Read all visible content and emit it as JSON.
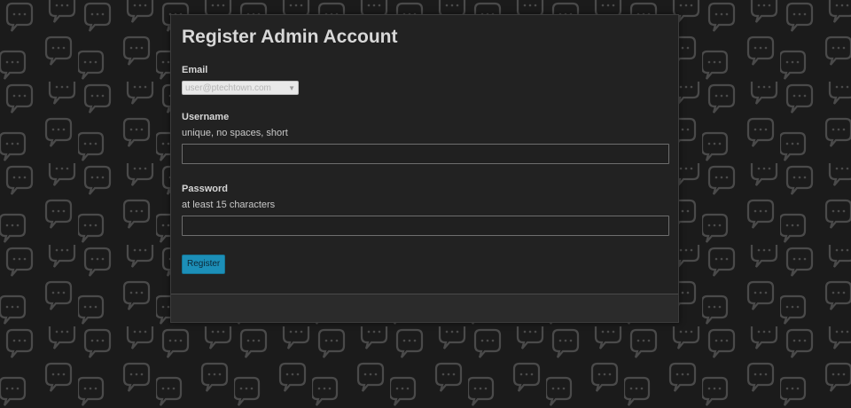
{
  "form": {
    "title": "Register Admin Account",
    "email": {
      "label": "Email",
      "selected_value": "user@ptechtown.com"
    },
    "username": {
      "label": "Username",
      "help": "unique, no spaces, short",
      "value": ""
    },
    "password": {
      "label": "Password",
      "help": "at least 15 characters",
      "value": ""
    },
    "submit_label": "Register"
  },
  "icons": {
    "select_arrow": "chevron-down-icon",
    "background": "speech-bubble-icon"
  },
  "colors": {
    "background": "#1b1b1b",
    "panel": "#222222",
    "panel_footer": "#2b2b2b",
    "accent_button": "#1c8fb8",
    "bubble_outline": "#4a4a4a"
  }
}
